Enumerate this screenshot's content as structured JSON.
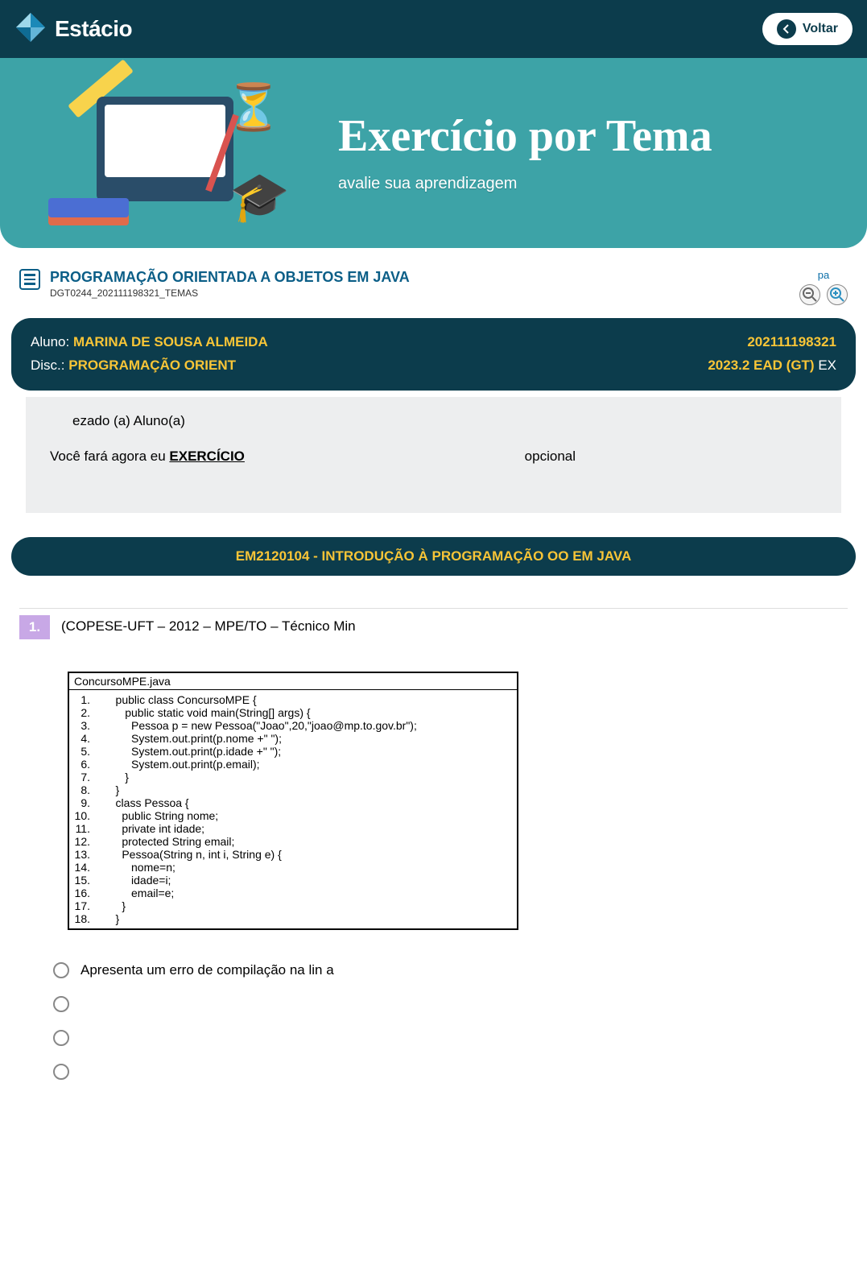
{
  "header": {
    "brand": "Estácio",
    "back_label": "Voltar"
  },
  "banner": {
    "title": "Exercício por Tema",
    "subtitle": "avalie sua aprendizagem"
  },
  "course": {
    "title": "PROGRAMAÇÃO ORIENTADA A OBJETOS EM JAVA",
    "code": "DGT0244_202111198321_TEMAS",
    "zoom_label": "pa"
  },
  "student_bar": {
    "aluno_label": "Aluno: ",
    "aluno_value": "MARINA DE SOUSA ALMEIDA",
    "disc_label": "Disc.: ",
    "disc_value": "PROGRAMAÇÃO ORIENT",
    "matricula": "202111198321",
    "turma": "2023.2 EAD (GT)",
    "turma_suffix": "   EX"
  },
  "info": {
    "line1": "ezado (a) Aluno(a)",
    "line2_left_a": "Você fará agora   eu ",
    "line2_left_b": "EXERCÍCIO",
    "line2_right": "opcional"
  },
  "topic_pill": "EM2120104 - INTRODUÇÃO À PROGRAMAÇÃO OO EM JAVA",
  "question": {
    "number": "1.",
    "stem": "(COPESE-UFT – 2012 – MPE/TO – Técnico Min",
    "code_title": "ConcursoMPE.java",
    "code_lines": [
      "    public class ConcursoMPE {",
      "       public static void main(String[] args) {",
      "         Pessoa p = new Pessoa(\"Joao\",20,\"joao@mp.to.gov.br\");",
      "         System.out.print(p.nome +\" \");",
      "         System.out.print(p.idade +\" \");",
      "         System.out.print(p.email);",
      "       }",
      "    }",
      "    class Pessoa {",
      "      public String nome;",
      "      private int idade;",
      "      protected String email;",
      "      Pessoa(String n, int i, String e) {",
      "         nome=n;",
      "         idade=i;",
      "         email=e;",
      "      }",
      "    }"
    ],
    "options": [
      "Apresenta um erro de compilação na lin   a",
      "",
      "",
      ""
    ]
  }
}
